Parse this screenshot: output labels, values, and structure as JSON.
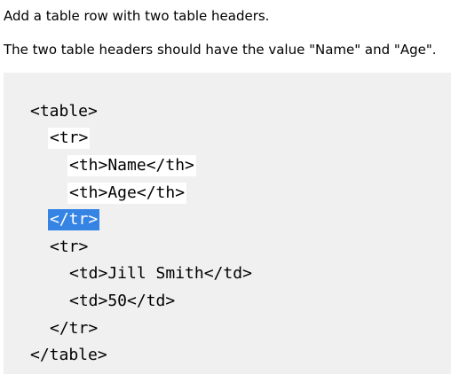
{
  "instructions": {
    "line1": "Add a table row with two table headers.",
    "line2": "The two table headers should have the value \"Name\" and \"Age\"."
  },
  "code": {
    "lines": [
      "<table>",
      "<tr>",
      "<th>Name</th>",
      "<th>Age</th>",
      "</tr>",
      "<tr>",
      "<td>Jill Smith</td>",
      "<td>50</td>",
      "</tr>",
      "</table>"
    ]
  },
  "colors": {
    "panel_background": "#f0f0f0",
    "selection": "#3584e4"
  }
}
